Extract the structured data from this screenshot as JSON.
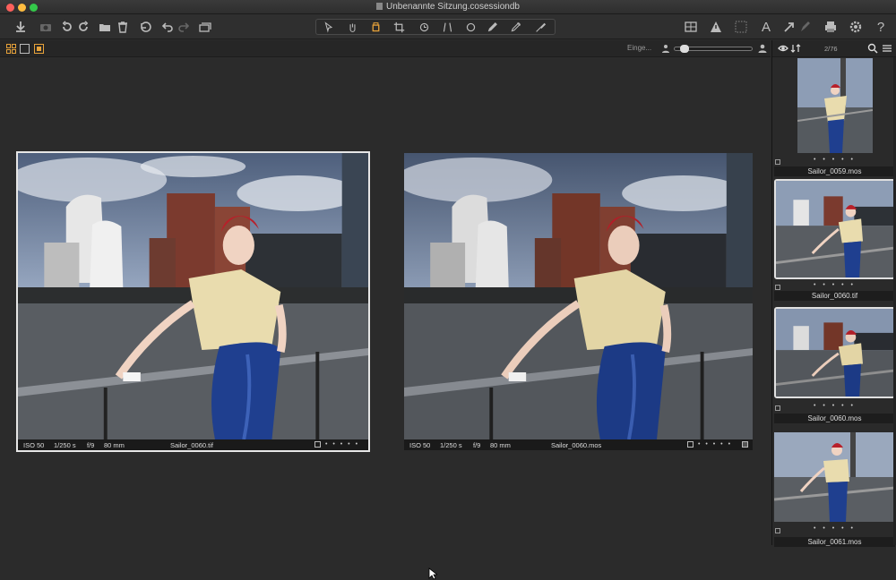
{
  "window": {
    "title": "Unbenannte Sitzung.cosessiondb"
  },
  "toolbar": {
    "left_icons": [
      "import-icon",
      "camera-icon",
      "rotate-left-icon",
      "rotate-right-icon",
      "folder-icon",
      "trash-icon",
      "reset-icon",
      "undo-icon",
      "redo-icon",
      "copy-icon"
    ],
    "tool_icons": [
      "select-icon",
      "hand-icon",
      "crop-bucket-icon",
      "crop-icon",
      "rotate-icon",
      "keystone-icon",
      "circle-icon",
      "brush-icon",
      "eraser-icon",
      "picker-icon"
    ],
    "right_icons": [
      "grid-icon",
      "warning-icon",
      "focus-icon",
      "text-icon",
      "apply-icon",
      "print-icon",
      "settings-icon",
      "help-icon"
    ],
    "text_icon_label": "A",
    "help_label": "?"
  },
  "subbar": {
    "filter_label": "Einge..."
  },
  "browser": {
    "counter": "2/76",
    "thumbnails": [
      {
        "name": "Sailor_0059.mos",
        "selected": false,
        "portrait": true
      },
      {
        "name": "Sailor_0060.tif",
        "selected": true,
        "portrait": false
      },
      {
        "name": "Sailor_0060.mos",
        "selected": true,
        "portrait": false
      },
      {
        "name": "Sailor_0061.mos",
        "selected": false,
        "portrait": false
      }
    ],
    "dots": "• • • • •"
  },
  "viewer": {
    "left": {
      "iso": "ISO 50",
      "shutter": "1/250 s",
      "aperture": "f/9",
      "focal": "80 mm",
      "filename": "Sailor_0060.tif",
      "dots": "• • • • •"
    },
    "right": {
      "iso": "ISO 50",
      "shutter": "1/250 s",
      "aperture": "f/9",
      "focal": "80 mm",
      "filename": "Sailor_0060.mos",
      "dots": "• • • • •"
    }
  },
  "colors": {
    "accent": "#e8a33a",
    "sky": "#7a92b8",
    "water": "#5a5e63",
    "skirt": "#1f3f8f",
    "blouse": "#e9dcae",
    "hair": "#b8202a"
  }
}
